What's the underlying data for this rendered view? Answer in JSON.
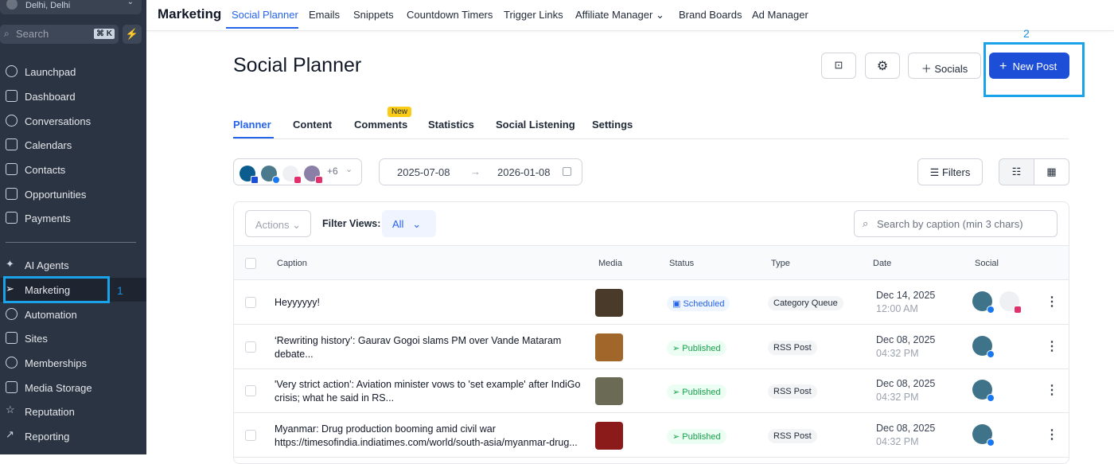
{
  "sidebar": {
    "location": "Delhi, Delhi",
    "search_placeholder": "Search",
    "shortcut": "⌘ K",
    "items": [
      {
        "label": "Launchpad"
      },
      {
        "label": "Dashboard"
      },
      {
        "label": "Conversations"
      },
      {
        "label": "Calendars"
      },
      {
        "label": "Contacts"
      },
      {
        "label": "Opportunities"
      },
      {
        "label": "Payments"
      },
      {
        "label": "AI Agents"
      },
      {
        "label": "Marketing"
      },
      {
        "label": "Automation"
      },
      {
        "label": "Sites"
      },
      {
        "label": "Memberships"
      },
      {
        "label": "Media Storage"
      },
      {
        "label": "Reputation"
      },
      {
        "label": "Reporting"
      }
    ]
  },
  "annotations": [
    "1",
    "2"
  ],
  "topbar": {
    "title": "Marketing",
    "tabs": [
      "Social Planner",
      "Emails",
      "Snippets",
      "Countdown Timers",
      "Trigger Links",
      "Affiliate Manager",
      "Brand Boards",
      "Ad Manager"
    ]
  },
  "page": {
    "title": "Social Planner",
    "socials_label": "Socials",
    "new_post_label": "New Post"
  },
  "subtabs": [
    "Planner",
    "Content",
    "Comments",
    "Statistics",
    "Social Listening",
    "Settings"
  ],
  "new_badge": "New",
  "accounts_more": "+6",
  "date_range": {
    "start": "2025-07-08",
    "end": "2026-01-08"
  },
  "filters_label": "Filters",
  "toolbar": {
    "actions": "Actions",
    "filter_views_label": "Filter Views:",
    "filter_view": "All",
    "search_placeholder": "Search by caption (min 3 chars)"
  },
  "table": {
    "headers": [
      "Caption",
      "Media",
      "Status",
      "Type",
      "Date",
      "Social"
    ],
    "rows": [
      {
        "caption": "Heyyyyyy!",
        "status": "Scheduled",
        "type": "Category Queue",
        "date": "Dec 14, 2025",
        "time": "12:00 AM"
      },
      {
        "caption": "‘Rewriting history’: Gaurav Gogoi slams PM over Vande Mataram debate...",
        "status": "Published",
        "type": "RSS Post",
        "date": "Dec 08, 2025",
        "time": "04:32 PM"
      },
      {
        "caption": "'Very strict action': Aviation minister vows to 'set example' after IndiGo crisis; what he said in RS...",
        "status": "Published",
        "type": "RSS Post",
        "date": "Dec 08, 2025",
        "time": "04:32 PM"
      },
      {
        "caption": "Myanmar: Drug production booming amid civil war https://timesofindia.indiatimes.com/world/south-asia/myanmar-drug...",
        "status": "Published",
        "type": "RSS Post",
        "date": "Dec 08, 2025",
        "time": "04:32 PM"
      }
    ]
  }
}
